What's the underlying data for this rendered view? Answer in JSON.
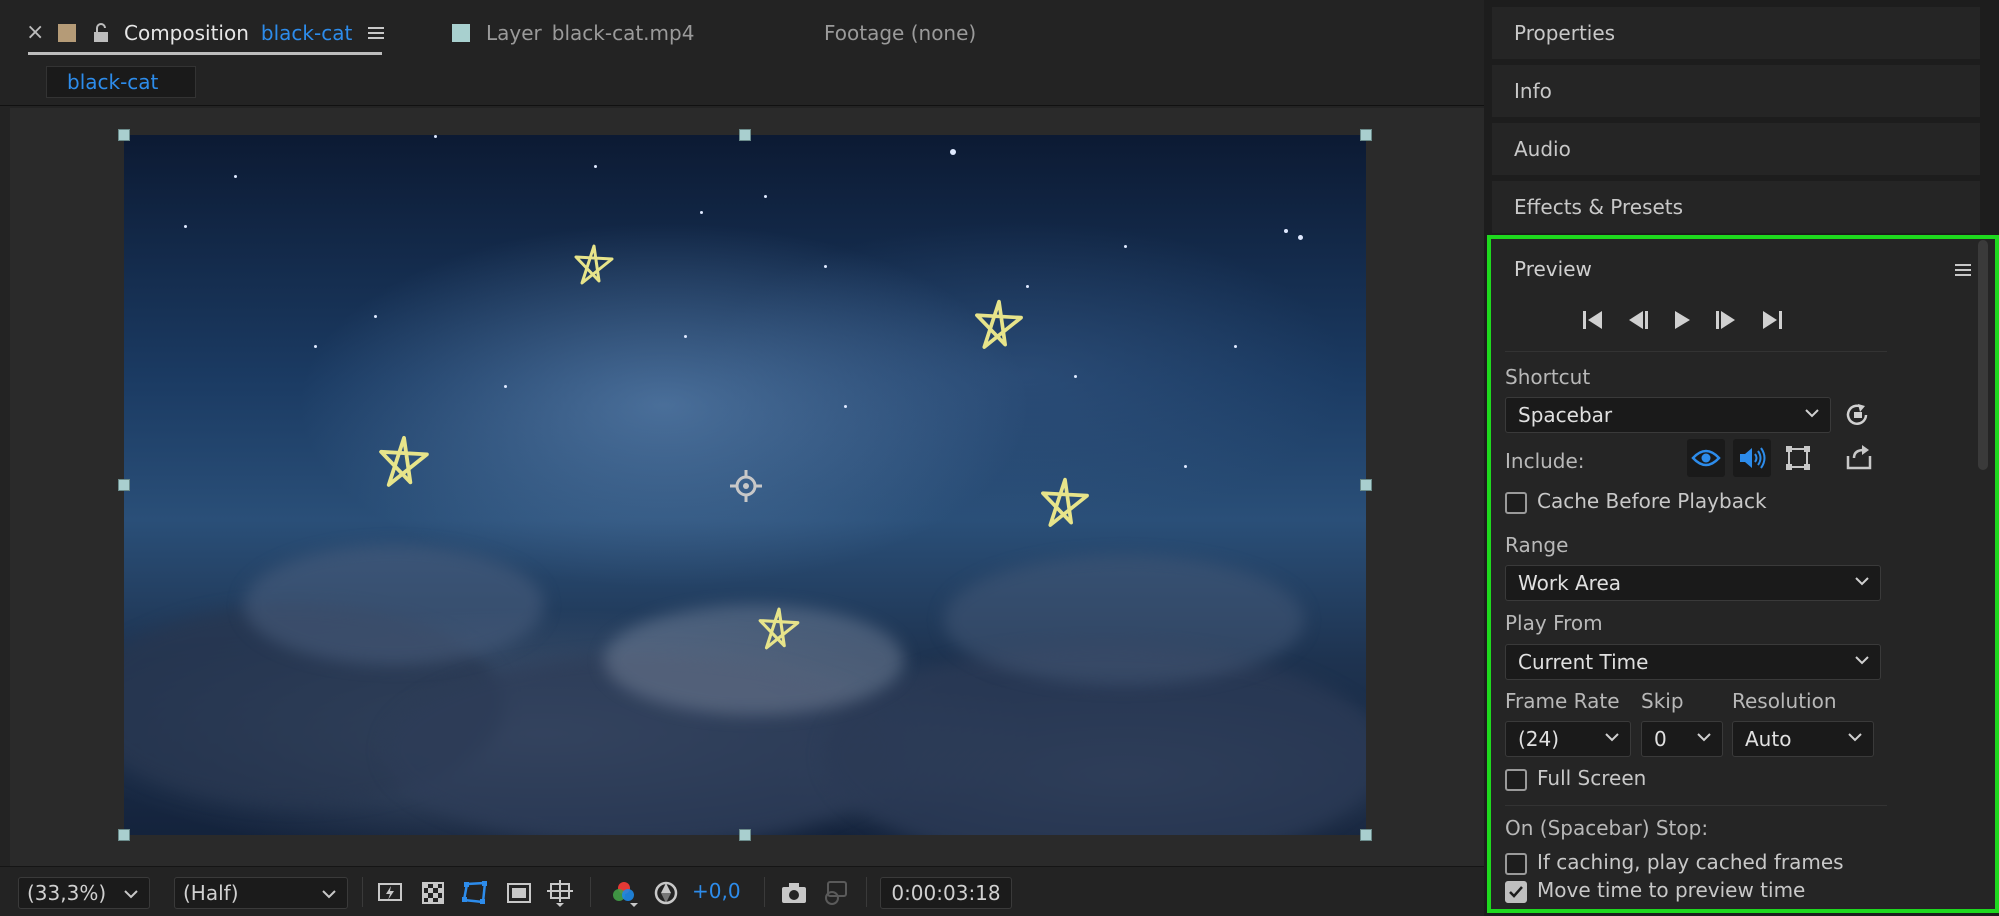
{
  "composition_panel": {
    "tabs": [
      {
        "prefix": "Composition",
        "name": "black-cat"
      },
      {
        "prefix": "Layer",
        "name": "black-cat.mp4"
      },
      {
        "prefix": "Footage (none)",
        "name": ""
      }
    ],
    "close_glyph": "×",
    "subtab": "black-cat",
    "colors": {
      "comp_swatch": "#b59b77",
      "layer_swatch": "#a8d0cf",
      "accent": "#2d8ceb"
    }
  },
  "viewer_toolbar": {
    "zoom": "(33,3%)",
    "resolution": "(Half)",
    "exposure": "+0,0",
    "timecode": "0:00:03:18",
    "icons": [
      "fast-preview-icon",
      "transparency-grid-icon",
      "mask-path-icon",
      "region-of-interest-icon",
      "guides-icon",
      "channels-icon",
      "reset-exposure-icon",
      "snapshot-icon",
      "show-snapshot-icon"
    ]
  },
  "right_panels": {
    "properties": "Properties",
    "info": "Info",
    "audio": "Audio",
    "effects": "Effects & Presets"
  },
  "preview": {
    "title": "Preview",
    "shortcut_label": "Shortcut",
    "shortcut_value": "Spacebar",
    "include_label": "Include:",
    "cache_before_playback": "Cache Before Playback",
    "range_label": "Range",
    "range_value": "Work Area",
    "play_from_label": "Play From",
    "play_from_value": "Current Time",
    "frame_rate_label": "Frame Rate",
    "frame_rate_value": "(24)",
    "skip_label": "Skip",
    "skip_value": "0",
    "resolution_label": "Resolution",
    "resolution_value": "Auto",
    "full_screen": "Full Screen",
    "on_stop_label": "On (Spacebar) Stop:",
    "if_caching": "If caching, play cached frames",
    "move_time": "Move time to preview time",
    "checkbox_states": {
      "cache_before_playback": false,
      "full_screen": false,
      "if_caching": false,
      "move_time": true
    },
    "highlight_color": "#1ed91e"
  }
}
